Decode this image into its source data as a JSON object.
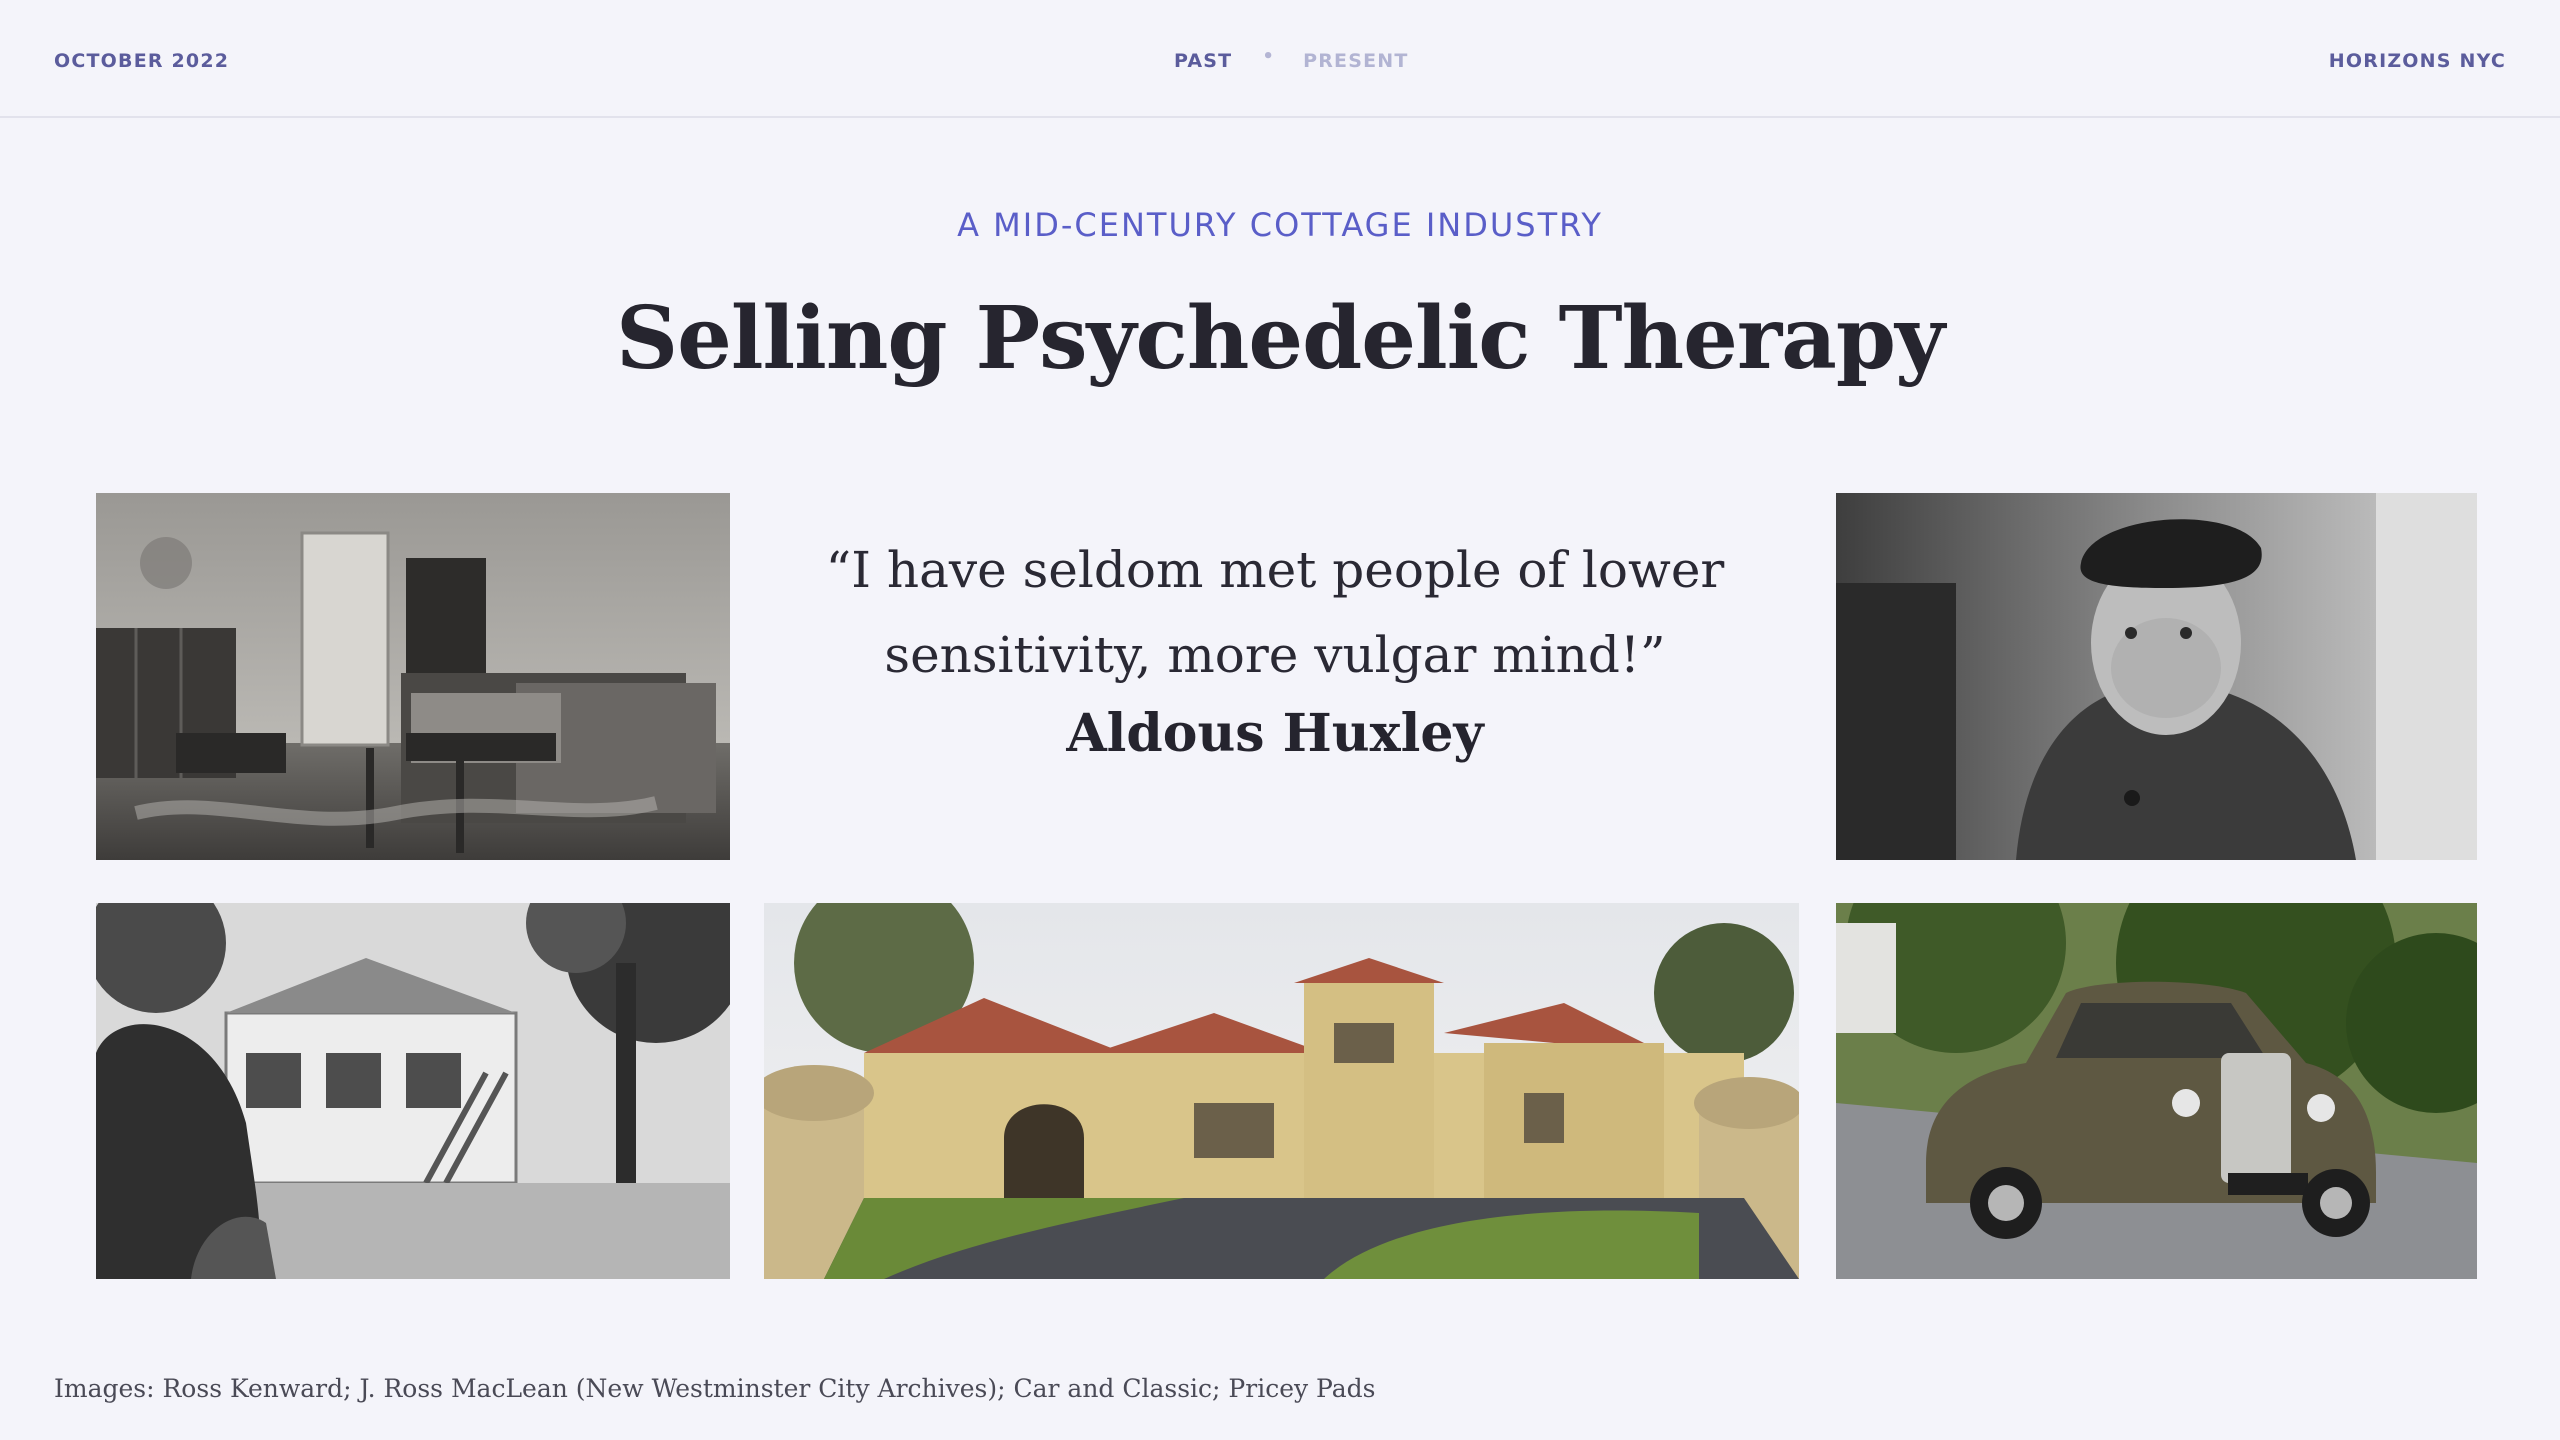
{
  "header": {
    "date": "OCTOBER 2022",
    "nav_past": "PAST",
    "nav_separator": "•",
    "nav_present": "PRESENT",
    "brand": "HORIZONS NYC"
  },
  "kicker": "A MID-CENTURY COTTAGE INDUSTRY",
  "title": "Selling Psychedelic Therapy",
  "quote": {
    "line1": "“I have seldom met people of lower",
    "line2": "sensitivity, more vulgar mind!”",
    "author": "Aldous Huxley"
  },
  "credits": "Images: Ross Kenward;  J. Ross MacLean (New Westminster City Archives); Car and Classic; Pricey Pads",
  "colors": {
    "background": "#f4f4fa",
    "accent": "#5a5ec8",
    "nav": "#5b5c9c",
    "text": "#26252f"
  }
}
